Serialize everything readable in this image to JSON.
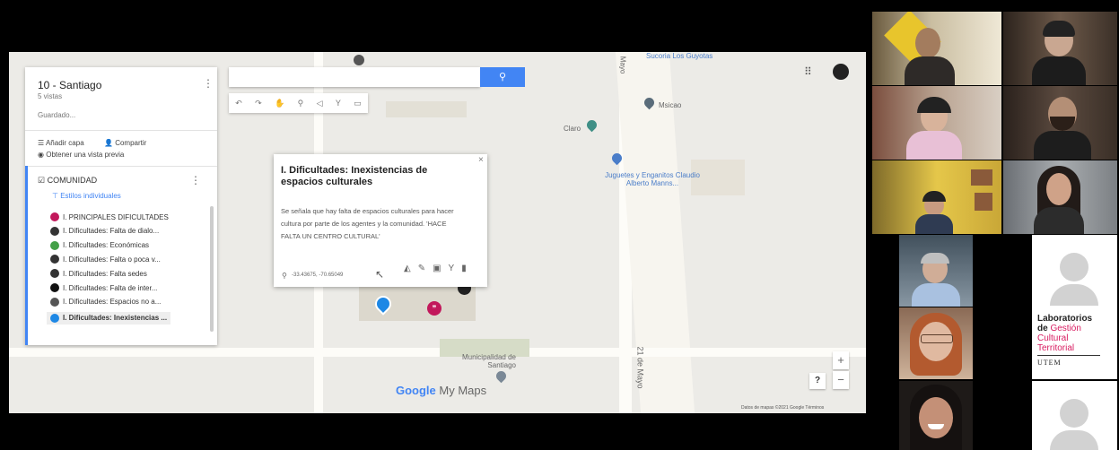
{
  "sidebar": {
    "title": "10 - Santiago",
    "views": "5 vistas",
    "saved": "Guardado...",
    "add_layer": "Añadir capa",
    "share": "Compartir",
    "preview": "Obtener una vista previa",
    "layer": {
      "name": "COMUNIDAD",
      "style": "Estilos individuales",
      "items": [
        {
          "label": "I. PRINCIPALES DIFICULTADES",
          "color": "#c2185b"
        },
        {
          "label": "I. Dificultades: Falta de dialo...",
          "color": "#333333"
        },
        {
          "label": "I. Dificultades: Económicas",
          "color": "#43a047"
        },
        {
          "label": "I. Dificultades: Falta o poca v...",
          "color": "#333333"
        },
        {
          "label": "I. Dificultades: Falta sedes",
          "color": "#333333"
        },
        {
          "label": "I. Dificultades: Falta de inter...",
          "color": "#111111"
        },
        {
          "label": "I. Dificultades: Espacios no a...",
          "color": "#555555"
        },
        {
          "label": "I. Dificultades: Inexistencias ...",
          "color": "#1e88e5"
        }
      ]
    }
  },
  "popup": {
    "title": "I. Dificultades: Inexistencias de espacios culturales",
    "body": "Se señala que hay falta de espacios culturales para hacer cultura por parte de los agentes y la comunidad. 'HACE FALTA UN CENTRO CULTURAL'",
    "coords": "-33.43675, -70.65049",
    "close": "×"
  },
  "map_labels": {
    "msicao": "Msicao",
    "claro": "Claro",
    "juguetes": "Juguetes y Enganitos Claudio Alberto Manns...",
    "municipalidad": "Municipalidad de Santiago",
    "street_top": "Mayo",
    "street_right": "21 de Mayo",
    "top_cut": "Sucoria Los Guyotas",
    "brand_google": "Google",
    "brand_mymaps": "My Maps",
    "attribution": "Datos de mapas ©2021 Google   Términos",
    "zoom_in": "+",
    "zoom_out": "−",
    "help": "?"
  },
  "utem": {
    "line1": "Laboratorios",
    "line2a": "de ",
    "line2b": "Gestión",
    "line3": "Cultural",
    "line4": "Territorial",
    "line5": "UTEM"
  },
  "colors": {
    "accent": "#4285f4",
    "utem_pink": "#d81b60"
  }
}
